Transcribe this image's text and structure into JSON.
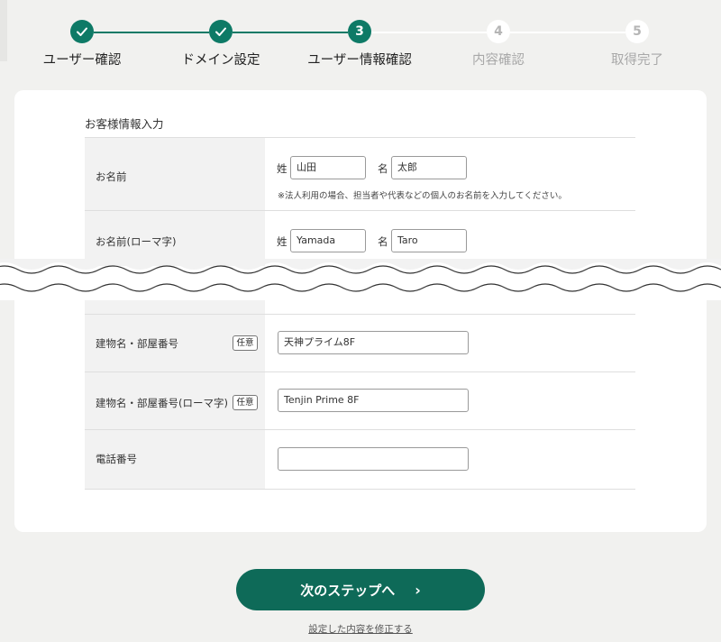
{
  "stepper": {
    "steps": [
      {
        "number": "✓",
        "label": "ユーザー確認",
        "status": "done"
      },
      {
        "number": "✓",
        "label": "ドメイン設定",
        "status": "done"
      },
      {
        "number": "3",
        "label": "ユーザー情報確認",
        "status": "active"
      },
      {
        "number": "4",
        "label": "内容確認",
        "status": "todo"
      },
      {
        "number": "5",
        "label": "取得完了",
        "status": "todo"
      }
    ]
  },
  "form": {
    "title": "お客様情報入力",
    "name": {
      "label": "お名前",
      "last_prefix": "姓",
      "last_value": "山田",
      "first_prefix": "名",
      "first_value": "太郎",
      "note": "※法人利用の場合、担当者や代表などの個人のお名前を入力してください。"
    },
    "name_roman": {
      "label": "お名前(ローマ字)",
      "last_prefix": "姓",
      "last_value": "Yamada",
      "first_prefix": "名",
      "first_value": "Taro"
    },
    "building": {
      "label": "建物名・部屋番号",
      "badge": "任意",
      "value": "天神プライム8F"
    },
    "building_roman": {
      "label": "建物名・部屋番号(ローマ字)",
      "badge": "任意",
      "value": "Tenjin Prime 8F"
    },
    "phone": {
      "label": "電話番号",
      "value": ""
    }
  },
  "actions": {
    "next_label": "次のステップへ",
    "next_chevron": "›",
    "edit_link": "設定した内容を修正する"
  },
  "colors": {
    "accent": "#0e7a66",
    "button": "#0e6a58",
    "background": "#f1f1ef"
  }
}
